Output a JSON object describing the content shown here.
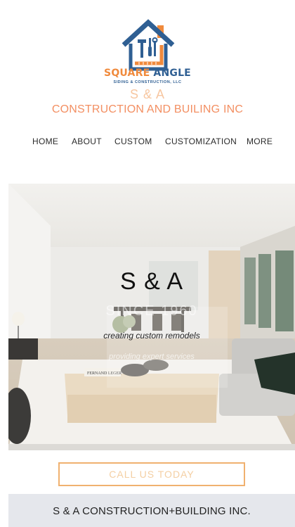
{
  "logo": {
    "name_part1": "SQUARE",
    "name_part2": "ANGLE",
    "subtitle": "SIDING & CONSTRUCTION, LLC",
    "icon": "house-tools-logo-icon",
    "colors": {
      "orange": "#f08a3c",
      "blue": "#2f5f93"
    }
  },
  "brand": {
    "short_name": "S & A",
    "full_name": "CONSTRUCTION AND BUILING INC"
  },
  "nav": {
    "items": [
      {
        "label": "HOME"
      },
      {
        "label": "ABOUT"
      },
      {
        "label": "CUSTOM"
      },
      {
        "label": "CUSTOMIZATION"
      },
      {
        "label": "MORE"
      }
    ]
  },
  "hero": {
    "title": "S & A",
    "since": "SINCE 1960",
    "tagline": "creating custom remodels",
    "tagline2": "providing expert services",
    "book_label": "FERNAND LEGER"
  },
  "cta": {
    "label": "CALL US TODAY",
    "border_color": "#f0b16f"
  },
  "footer": {
    "text": "S & A CONSTRUCTION+BUILDING INC."
  }
}
